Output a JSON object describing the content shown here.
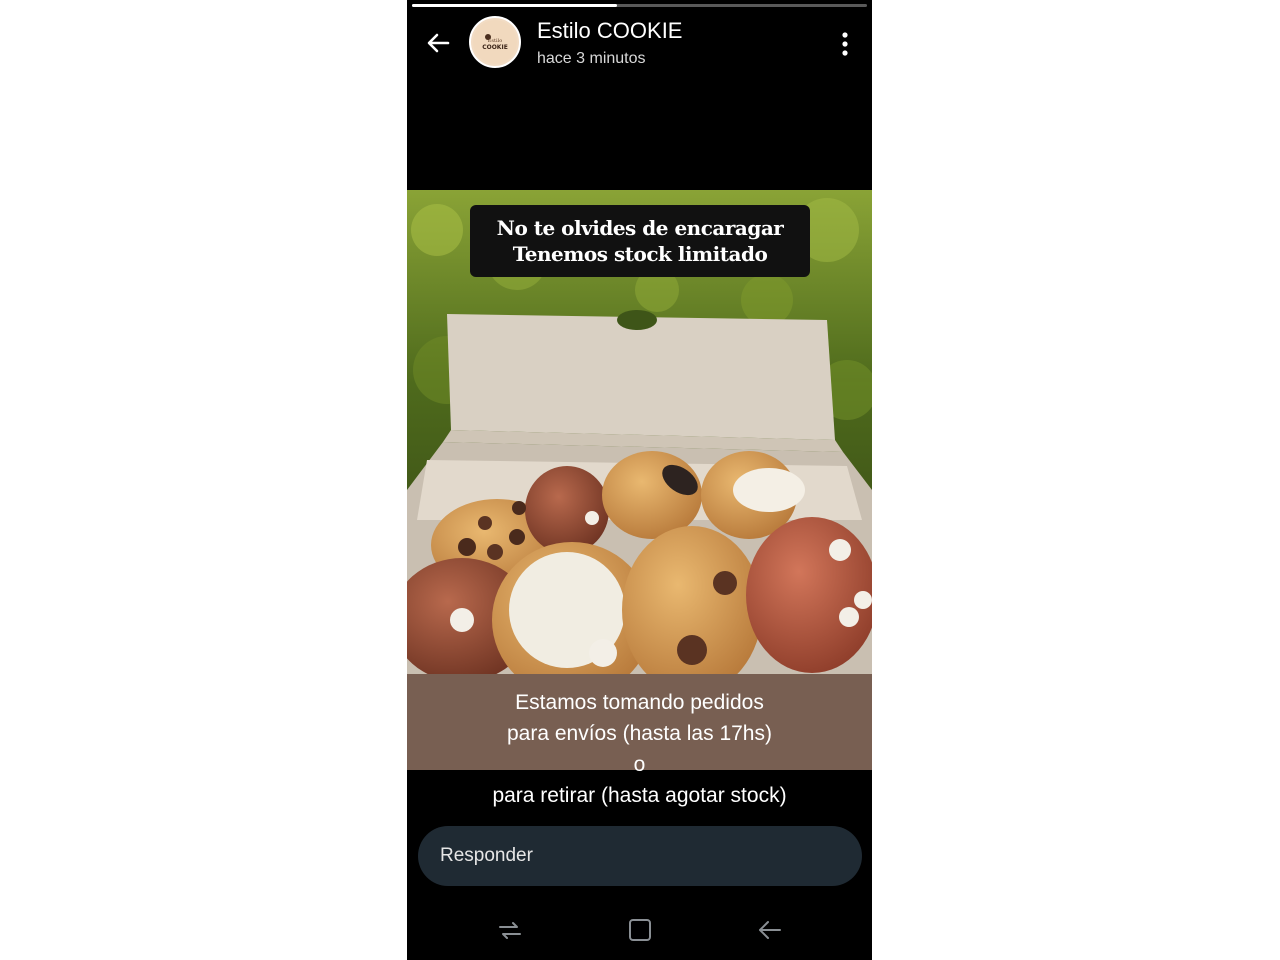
{
  "story": {
    "progress": 0.45,
    "account_name": "Estilo COOKIE",
    "posted": "hace 3 minutos",
    "avatar_text": [
      "Estilo",
      "COOKIE"
    ]
  },
  "overlay": {
    "headline_line1": "No te olvides de encaragar",
    "headline_line2": "Tenemos stock limitado",
    "caption_lines": [
      "Estamos tomando pedidos",
      "para envíos (hasta las 17hs)",
      "o",
      "para  retirar (hasta agotar stock)"
    ]
  },
  "reply": {
    "placeholder": "Responder"
  },
  "icons": {
    "back": "arrow-back-icon",
    "menu": "more-vertical-icon",
    "recents": "recent-apps-icon",
    "home": "home-icon",
    "nav_back": "nav-back-icon"
  },
  "colors": {
    "background": "#000000",
    "caption_band": "#7e6456",
    "reply_field": "#1f2a33"
  }
}
